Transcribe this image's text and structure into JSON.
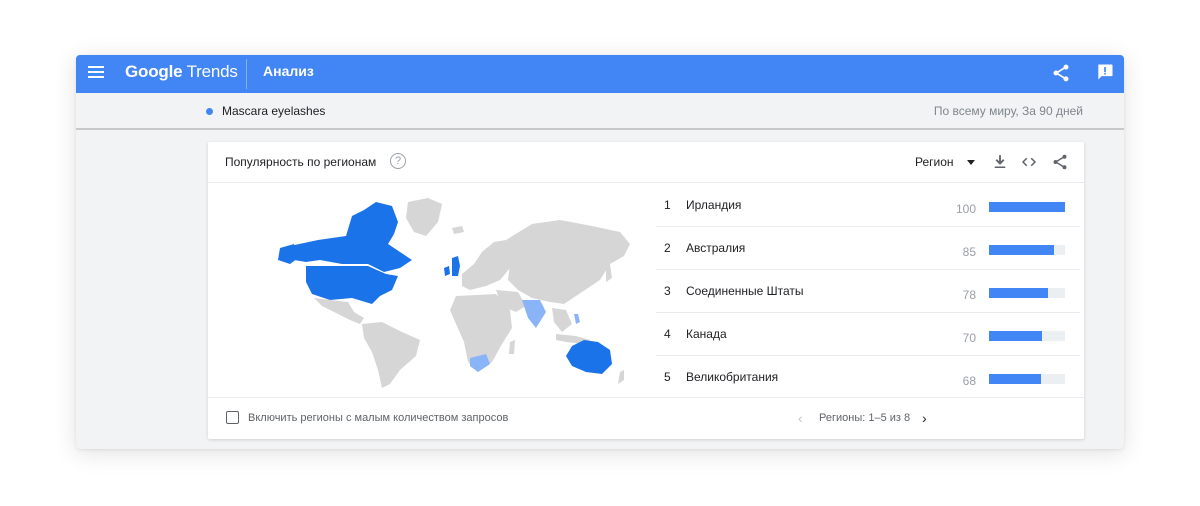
{
  "header": {
    "brand_word1": "Google",
    "brand_word2": "Trends",
    "title": "Анализ",
    "background": "#4285f4",
    "share_icon": "share-icon",
    "feedback_icon": "feedback-icon"
  },
  "comparison": {
    "term": "Mascara eyelashes",
    "term_color": "#4285f4",
    "scope": "По всему миру, За 90 дней"
  },
  "card": {
    "title": "Популярность по регионам",
    "help_glyph": "?",
    "resolution_label": "Регион"
  },
  "regions": [
    {
      "rank": "1",
      "name": "Ирландия",
      "value": "100",
      "score": 100
    },
    {
      "rank": "2",
      "name": "Австралия",
      "value": "85",
      "score": 85
    },
    {
      "rank": "3",
      "name": "Соединенные Штаты",
      "value": "78",
      "score": 78
    },
    {
      "rank": "4",
      "name": "Канада",
      "value": "70",
      "score": 70
    },
    {
      "rank": "5",
      "name": "Великобритания",
      "value": "68",
      "score": 68
    }
  ],
  "footer": {
    "checkbox_label": "Включить регионы с малым количеством запросов",
    "pagination": "Регионы: 1–5 из 8",
    "prev_glyph": "‹",
    "next_glyph": "›"
  },
  "colors": {
    "accent": "#4285f4",
    "land": "#d6d6d6",
    "highlight": "#1a73e8",
    "highlight_light": "#8ab4f8"
  }
}
